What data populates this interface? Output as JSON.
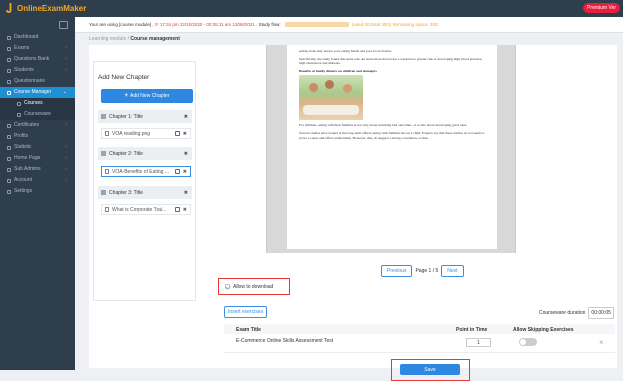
{
  "app": {
    "logo_text": "OnlineExamMaker",
    "premium_badge": "Premium Ver"
  },
  "sidebar": {
    "items": [
      {
        "label": "Dashboard",
        "icon": "dashboard-icon",
        "chevron": ""
      },
      {
        "label": "Exams",
        "icon": "exam-icon",
        "chevron": "‹"
      },
      {
        "label": "Questions Bank",
        "icon": "question-icon",
        "chevron": "‹"
      },
      {
        "label": "Students",
        "icon": "students-icon",
        "chevron": "‹"
      },
      {
        "label": "Questionnaire",
        "icon": "questionnaire-icon",
        "chevron": ""
      },
      {
        "label": "Course Manager",
        "icon": "course-icon",
        "chevron": "⌄"
      },
      {
        "label": "Courses",
        "icon": "courses-icon",
        "chevron": ""
      },
      {
        "label": "Courseware",
        "icon": "courseware-icon",
        "chevron": ""
      },
      {
        "label": "Certificates",
        "icon": "certificate-icon",
        "chevron": "‹"
      },
      {
        "label": "Profits",
        "icon": "profit-icon",
        "chevron": ""
      },
      {
        "label": "Statistic",
        "icon": "statistic-icon",
        "chevron": "‹"
      },
      {
        "label": "Home Page",
        "icon": "home-icon",
        "chevron": "‹"
      },
      {
        "label": "Sub Admins",
        "icon": "admins-icon",
        "chevron": "‹"
      },
      {
        "label": "Account",
        "icon": "account-icon",
        "chevron": "‹"
      },
      {
        "label": "Settings",
        "icon": "settings-icon",
        "chevron": ""
      }
    ]
  },
  "infobar": {
    "prefix": "Your are using [course module] , ",
    "validity": "!!! 17:34 pm 22/10/2020 - 00:35:11 am 13/08/2021",
    "study_flow": " . Study flow: ",
    "used": "(used 0G/total 30G) Remaining space: 30G"
  },
  "breadcrumb": {
    "parent": "Learning module / ",
    "current": "Course management"
  },
  "chapters_panel": {
    "title": "Add New Chapter",
    "add_button": "Add New Chapter",
    "chapters": [
      {
        "title": "Chapter 1: Title",
        "lesson": "VOA reading.png"
      },
      {
        "title": "Chapter 2: Title",
        "lesson": "VOA-Benefits of Eating ..."
      },
      {
        "title": "Chapter 3: Title",
        "lesson": "What is Corporate Trai..."
      }
    ]
  },
  "document": {
    "p1": "eating alone may lead to poor eating habits and poor food choices.",
    "p2": "Specifically, the study found that teens who ate alone more than twice a week had a greater risk of developing high blood pressure, high cholesterol and diabetes.",
    "heading": "Benefits of family dinners on children and teenagers",
    "p3": "For children, eating with their families is not only about nurturing bad outcomes - it is also about developing good ones.",
    "p4": "Several studies have looked at the long-term effects eating with families has on a child. Experts say that these studies do not seem to prove a cause-and-effect relationship. However, they do suggest a strong correlation, or link."
  },
  "pager": {
    "prev": "Previous",
    "info": "Page 1 / 5",
    "next": "Next"
  },
  "options": {
    "allow_download": "Allow to download"
  },
  "exercises": {
    "insert_button": "Insert exercises",
    "duration_label": "Courseware duration",
    "duration_value": "00:00:05",
    "columns": [
      "Exam Title",
      "Point in Time",
      "Allow Skipping Exercises"
    ],
    "rows": [
      {
        "title": "E-Commerce Online Skills Assessment Test",
        "point": "1",
        "allow_skip": false
      }
    ]
  },
  "actions": {
    "save": "Save"
  },
  "colors": {
    "sidebar_bg": "#2f3e4d",
    "accent": "#1e8fd5",
    "button": "#2e87e0",
    "highlight": "#e53935"
  }
}
